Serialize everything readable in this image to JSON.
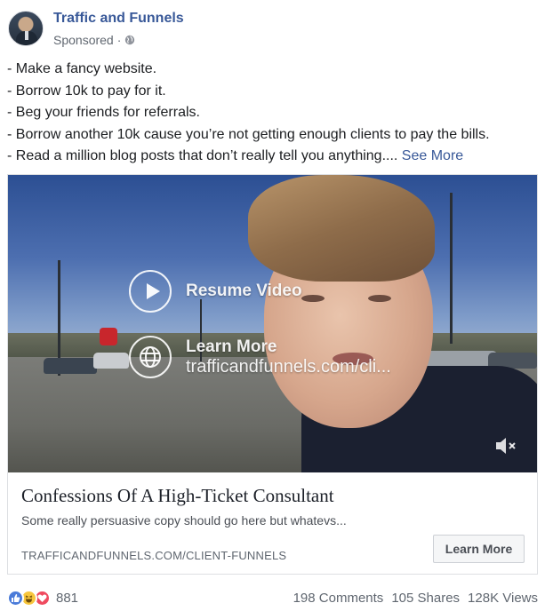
{
  "post": {
    "page_name": "Traffic and Funnels",
    "sponsored_label": "Sponsored",
    "separator": "·",
    "lines": [
      "- Make a fancy website.",
      "- Borrow 10k to pay for it.",
      "- Beg your friends for referrals.",
      "- Borrow another 10k cause you’re not getting enough clients to pay the bills.",
      "- Read a million blog posts that don’t really tell you anything.... "
    ],
    "see_more": "See More"
  },
  "video": {
    "resume_label": "Resume Video",
    "learn_more_label": "Learn More",
    "learn_more_url": "trafficandfunnels.com/cli..."
  },
  "card": {
    "title": "Confessions Of A High-Ticket Consultant",
    "description": "Some really persuasive copy should go here but whatevs...",
    "domain": "TRAFFICANDFUNNELS.COM/CLIENT-FUNNELS",
    "cta_label": "Learn More"
  },
  "footer": {
    "reaction_count": "881",
    "comments": "198 Comments",
    "shares": "105 Shares",
    "views": "128K Views"
  },
  "icons": {
    "globe": "globe-icon",
    "play": "play-icon",
    "mute": "mute-icon",
    "like": "like-reaction-icon",
    "haha": "haha-reaction-icon",
    "love": "love-reaction-icon"
  },
  "colors": {
    "link_blue": "#385898",
    "text_dark": "#1c1e21",
    "muted": "#606770",
    "like": "#4a7bd9",
    "haha": "#f7c63d",
    "love": "#ef4a5f"
  }
}
